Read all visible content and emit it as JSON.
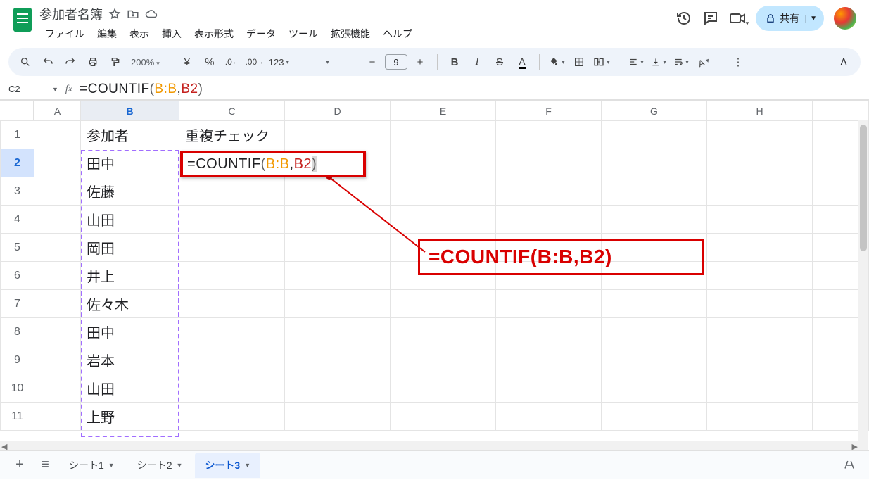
{
  "doc_title": "参加者名簿",
  "menus": {
    "file": "ファイル",
    "edit": "編集",
    "view": "表示",
    "insert": "挿入",
    "format": "表示形式",
    "data": "データ",
    "tools": "ツール",
    "extensions": "拡張機能",
    "help": "ヘルプ"
  },
  "share_label": "共有",
  "zoom": "200%",
  "font_size": "9",
  "number_fmt": "123",
  "name_box": "C2",
  "formula_plain": "=COUNTIF(B:B,B2)",
  "formula": {
    "eq": "=",
    "fn": "COUNTIF",
    "open": "(",
    "range": "B:B",
    "comma": ",",
    "ref": "B2",
    "close": ")"
  },
  "columns": [
    "A",
    "B",
    "C",
    "D",
    "E",
    "F",
    "G",
    "H"
  ],
  "selected_col_idx": 1,
  "selected_row_idx": 1,
  "rows": [
    {
      "n": "1",
      "b": "参加者",
      "c": "重複チェック"
    },
    {
      "n": "2",
      "b": "田中",
      "c": ""
    },
    {
      "n": "3",
      "b": "佐藤",
      "c": ""
    },
    {
      "n": "4",
      "b": "山田",
      "c": ""
    },
    {
      "n": "5",
      "b": "岡田",
      "c": ""
    },
    {
      "n": "6",
      "b": "井上",
      "c": ""
    },
    {
      "n": "7",
      "b": "佐々木",
      "c": ""
    },
    {
      "n": "8",
      "b": "田中",
      "c": ""
    },
    {
      "n": "9",
      "b": "岩本",
      "c": ""
    },
    {
      "n": "10",
      "b": "山田",
      "c": ""
    },
    {
      "n": "11",
      "b": "上野",
      "c": ""
    }
  ],
  "callout": "=COUNTIF(B:B,B2)",
  "sheets": {
    "s1": "シート1",
    "s2": "シート2",
    "s3": "シート3",
    "active": 2
  }
}
